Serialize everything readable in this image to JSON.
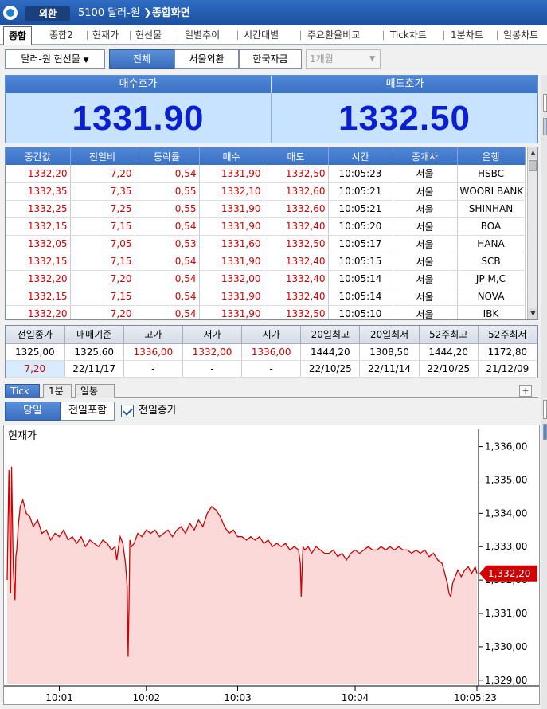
{
  "titlebar": {
    "badge": "외환",
    "code_title": "5100 달러-원",
    "screen_title": "종합화면"
  },
  "tabs": [
    "종합",
    "종합2",
    "현재가",
    "현선물",
    "일별추이",
    "시간대별",
    "주요환율비교",
    "Tick차트",
    "1분차트",
    "일봉차트"
  ],
  "controls": {
    "instrument": "달러-원 현선물",
    "filter_all": "전체",
    "filter_seoul": "서울외환",
    "filter_korea": "한국자금",
    "period": "1개월"
  },
  "quote": {
    "bid_label": "매수호가",
    "bid_value": "1331.90",
    "ask_label": "매도호가",
    "ask_value": "1332.50"
  },
  "tick_table": {
    "headers": [
      "중간값",
      "전일비",
      "등락률",
      "매수",
      "매도",
      "시간",
      "중개사",
      "은행"
    ],
    "rows": [
      [
        "1332,20",
        "7,20",
        "0,54",
        "1331,90",
        "1332,50",
        "10:05:23",
        "서울",
        "HSBC"
      ],
      [
        "1332,35",
        "7,35",
        "0,55",
        "1332,10",
        "1332,60",
        "10:05:21",
        "서울",
        "WOORI BANK"
      ],
      [
        "1332,25",
        "7,25",
        "0,55",
        "1331,90",
        "1332,60",
        "10:05:21",
        "서울",
        "SHINHAN"
      ],
      [
        "1332,15",
        "7,15",
        "0,54",
        "1331,90",
        "1332,40",
        "10:05:20",
        "서울",
        "BOA"
      ],
      [
        "1332,05",
        "7,05",
        "0,53",
        "1331,60",
        "1332,50",
        "10:05:17",
        "서울",
        "HANA"
      ],
      [
        "1332,15",
        "7,15",
        "0,54",
        "1331,90",
        "1332,40",
        "10:05:15",
        "서울",
        "SCB"
      ],
      [
        "1332,20",
        "7,20",
        "0,54",
        "1332,00",
        "1332,40",
        "10:05:14",
        "서울",
        "JP M,C"
      ],
      [
        "1332,15",
        "7,15",
        "0,54",
        "1331,90",
        "1332,40",
        "10:05:14",
        "서울",
        "NOVA"
      ],
      [
        "1332,20",
        "7,20",
        "0,54",
        "1331,90",
        "1332,50",
        "10:05:10",
        "서울",
        "IBK"
      ]
    ]
  },
  "summary": {
    "headers": [
      "전일종가",
      "매매기준",
      "고가",
      "저가",
      "시가",
      "20일최고",
      "20일최저",
      "52주최고",
      "52주최저"
    ],
    "row1": [
      "1325,00",
      "1325,60",
      "1336,00",
      "1332,00",
      "1336,00",
      "1444,20",
      "1308,50",
      "1444,20",
      "1172,80"
    ],
    "row2": [
      "7,20",
      "22/11/17",
      "-",
      "-",
      "-",
      "22/10/25",
      "22/11/14",
      "22/10/25",
      "21/12/09"
    ]
  },
  "chart_tabs": [
    "Tick",
    "1분",
    "일봉"
  ],
  "chart_controls": {
    "today": "당일",
    "include_prev": "전일포함",
    "prev_close_label": "전일종가",
    "prev_close_checked": true
  },
  "chart_data": {
    "type": "area",
    "title": "현재가",
    "ylim": [
      1328.9,
      1336.3
    ],
    "y_ticks": [
      "1,336,00",
      "1,335,00",
      "1,334,00",
      "1,333,00",
      "1,332,00",
      "1,331,00",
      "1,330,00",
      "1,329,00"
    ],
    "y_tick_values": [
      1336,
      1335,
      1334,
      1333,
      1332,
      1331,
      1330,
      1329
    ],
    "x_ticks": [
      "10:01",
      "10:02",
      "10:03",
      "10:04",
      "10:05:23"
    ],
    "x_tick_values": [
      60,
      160,
      265,
      400,
      540
    ],
    "current_value_label": "1,332,20",
    "current_value": 1332.2,
    "x": [
      0,
      2,
      4,
      5,
      7,
      9,
      10,
      11,
      13,
      15,
      18,
      22,
      26,
      30,
      35,
      40,
      45,
      50,
      55,
      60,
      65,
      70,
      75,
      80,
      85,
      90,
      95,
      100,
      105,
      110,
      115,
      120,
      124,
      126,
      128,
      130,
      133,
      136,
      138,
      139,
      140,
      141,
      143,
      146,
      150,
      155,
      160,
      165,
      170,
      175,
      180,
      185,
      190,
      195,
      200,
      205,
      210,
      215,
      220,
      225,
      230,
      235,
      240,
      245,
      250,
      255,
      260,
      265,
      270,
      275,
      280,
      285,
      290,
      295,
      300,
      305,
      310,
      315,
      320,
      325,
      330,
      335,
      337,
      338,
      339,
      340,
      342,
      346,
      350,
      355,
      360,
      365,
      370,
      375,
      380,
      385,
      390,
      395,
      400,
      405,
      410,
      415,
      420,
      425,
      430,
      435,
      440,
      445,
      450,
      455,
      460,
      465,
      470,
      475,
      480,
      485,
      490,
      495,
      500,
      503,
      506,
      508,
      510,
      512,
      515,
      518,
      522,
      526,
      530,
      534,
      538,
      540
    ],
    "values": [
      1332.0,
      1335.3,
      1331.6,
      1335.4,
      1332.4,
      1331.4,
      1332.7,
      1332.9,
      1333.7,
      1334.2,
      1334.4,
      1334.0,
      1333.9,
      1333.6,
      1333.8,
      1333.4,
      1333.5,
      1333.2,
      1333.4,
      1333.3,
      1333.5,
      1333.2,
      1333.3,
      1333.1,
      1333.3,
      1333.0,
      1333.2,
      1333.1,
      1333.0,
      1333.2,
      1333.1,
      1332.9,
      1333.0,
      1332.6,
      1333.0,
      1333.3,
      1333.1,
      1332.5,
      1331.8,
      1329.7,
      1331.2,
      1333.2,
      1333.0,
      1333.1,
      1333.4,
      1333.3,
      1333.5,
      1333.4,
      1333.5,
      1333.3,
      1333.4,
      1333.5,
      1333.3,
      1333.5,
      1333.6,
      1333.4,
      1333.7,
      1333.5,
      1333.8,
      1333.6,
      1334.0,
      1334.2,
      1334.1,
      1333.9,
      1333.6,
      1333.4,
      1333.5,
      1333.3,
      1333.3,
      1333.2,
      1333.3,
      1333.2,
      1333.3,
      1333.1,
      1333.2,
      1333.0,
      1333.1,
      1333.0,
      1333.1,
      1332.9,
      1333.0,
      1332.9,
      1332.5,
      1331.5,
      1332.3,
      1333.0,
      1332.9,
      1333.0,
      1332.8,
      1333.0,
      1332.9,
      1332.8,
      1332.8,
      1332.9,
      1332.7,
      1332.8,
      1332.6,
      1332.8,
      1332.9,
      1332.8,
      1332.9,
      1333.0,
      1332.9,
      1332.9,
      1333.0,
      1332.9,
      1333.0,
      1332.9,
      1333.0,
      1332.9,
      1332.9,
      1332.8,
      1332.9,
      1332.8,
      1332.9,
      1332.7,
      1332.8,
      1332.6,
      1332.5,
      1332.2,
      1331.9,
      1331.6,
      1331.5,
      1331.9,
      1332.1,
      1332.3,
      1332.1,
      1332.3,
      1332.4,
      1332.2,
      1332.4,
      1332.2
    ],
    "colors": {
      "line": "#d00000",
      "fill": "#fbd9d9"
    }
  }
}
